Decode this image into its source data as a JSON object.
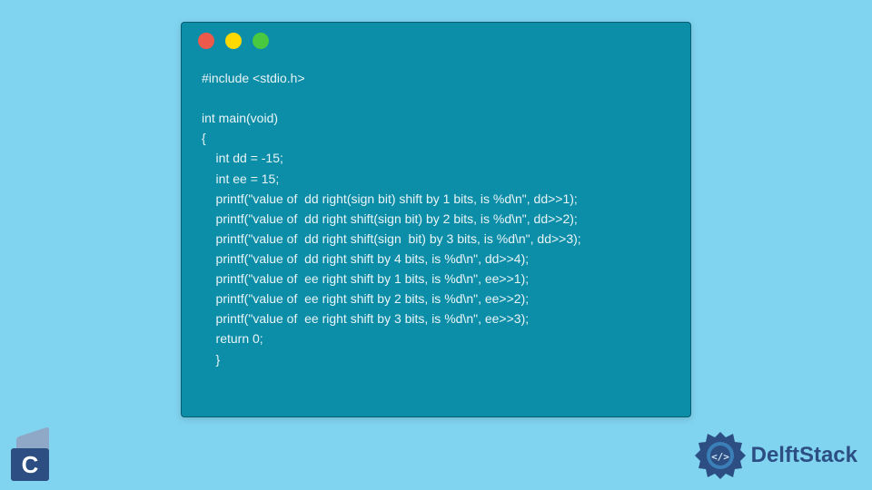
{
  "code": {
    "lines": [
      "#include <stdio.h>",
      "",
      "int main(void)",
      "{",
      "    int dd = -15;",
      "    int ee = 15;",
      "    printf(\"value of  dd right(sign bit) shift by 1 bits, is %d\\n\", dd>>1);",
      "    printf(\"value of  dd right shift(sign bit) by 2 bits, is %d\\n\", dd>>2);",
      "    printf(\"value of  dd right shift(sign  bit) by 3 bits, is %d\\n\", dd>>3);",
      "    printf(\"value of  dd right shift by 4 bits, is %d\\n\", dd>>4);",
      "    printf(\"value of  ee right shift by 1 bits, is %d\\n\", ee>>1);",
      "    printf(\"value of  ee right shift by 2 bits, is %d\\n\", ee>>2);",
      "    printf(\"value of  ee right shift by 3 bits, is %d\\n\", ee>>3);",
      "    return 0;",
      "    }"
    ]
  },
  "logos": {
    "c_letter": "C",
    "delft": "DelftStack"
  },
  "colors": {
    "page_bg": "#81d4f0",
    "window_bg": "#0d8ea8",
    "dot_red": "#ed594a",
    "dot_yellow": "#fdd900",
    "dot_green": "#48c93f",
    "brand_text": "#2c4e82"
  }
}
